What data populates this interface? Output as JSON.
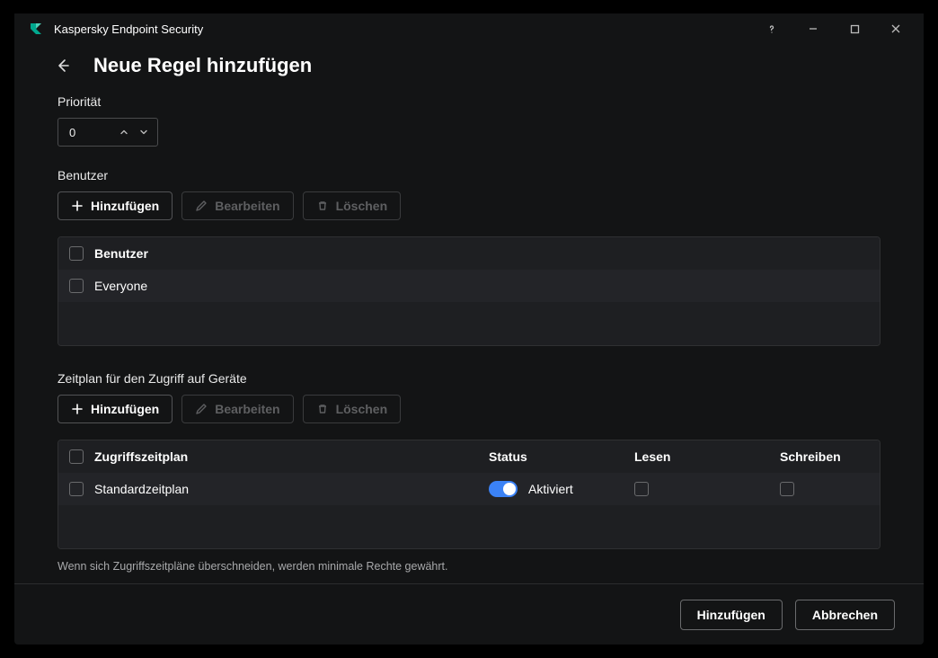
{
  "titlebar": {
    "app_name": "Kaspersky Endpoint Security"
  },
  "header": {
    "title": "Neue Regel hinzufügen"
  },
  "priority": {
    "label": "Priorität",
    "value": "0"
  },
  "users_section": {
    "label": "Benutzer",
    "add_label": "Hinzufügen",
    "edit_label": "Bearbeiten",
    "delete_label": "Löschen",
    "header_col": "Benutzer",
    "rows": [
      {
        "name": "Everyone"
      }
    ]
  },
  "schedule_section": {
    "label": "Zeitplan für den Zugriff auf Geräte",
    "add_label": "Hinzufügen",
    "edit_label": "Bearbeiten",
    "delete_label": "Löschen",
    "columns": {
      "plan": "Zugriffszeitplan",
      "status": "Status",
      "read": "Lesen",
      "write": "Schreiben"
    },
    "rows": [
      {
        "plan": "Standardzeitplan",
        "status_label": "Aktiviert"
      }
    ]
  },
  "note": "Wenn sich Zugriffszeitpläne überschneiden, werden minimale Rechte gewährt.",
  "footer": {
    "add_label": "Hinzufügen",
    "cancel_label": "Abbrechen"
  }
}
